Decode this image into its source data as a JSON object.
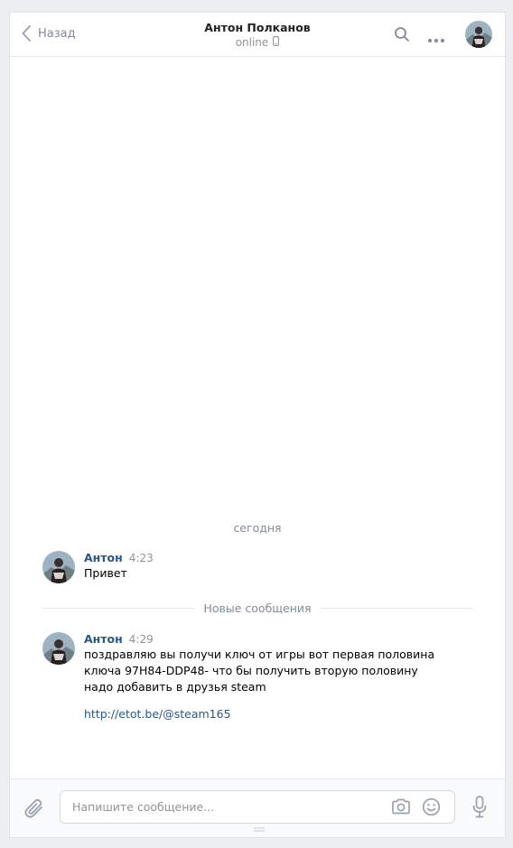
{
  "header": {
    "back_label": "Назад",
    "peer_name": "Антон Полканов",
    "peer_status": "online",
    "icons": [
      "chevron-left-icon",
      "phone-icon",
      "search-icon",
      "more-icon"
    ]
  },
  "history": {
    "date_separator": "сегодня",
    "new_messages_separator": "Новые сообщения"
  },
  "messages": [
    {
      "author": "Антон",
      "time": "4:23",
      "text": "Привет"
    },
    {
      "author": "Антон",
      "time": "4:29",
      "text": "поздравляю вы получи ключ от игры вот первая половина ключа 97H84-DDP48- что бы получить вторую половину надо добавить в друзья steam",
      "link": "http://etot.be/@steam165"
    }
  ],
  "composer": {
    "placeholder": "Напишите сообщение...",
    "value": "",
    "icons": [
      "paperclip-icon",
      "camera-icon",
      "smile-icon",
      "microphone-icon"
    ]
  },
  "colors": {
    "link": "#2a5885",
    "muted": "#828a99",
    "background": "#edeef0"
  }
}
